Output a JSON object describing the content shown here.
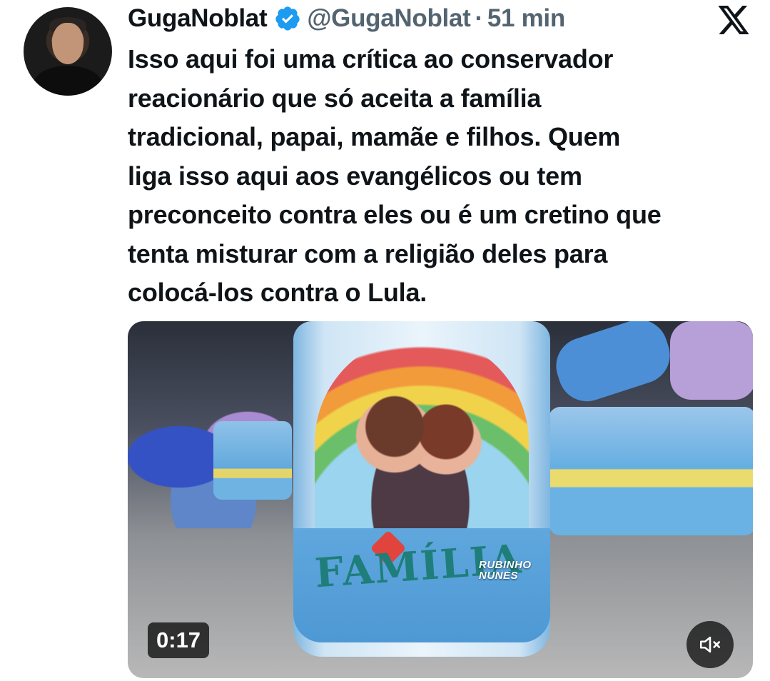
{
  "tweet": {
    "author_name": "GugaNoblat",
    "handle": "@GugaNoblat",
    "separator": "·",
    "time": "51 min",
    "verified": true,
    "text_lines": [
      "Isso aqui foi uma crítica ao conservador",
      "reacionário que só aceita a família",
      "tradicional, papai, mamãe e filhos. Quem",
      "liga isso aqui aos evangélicos ou tem",
      "preconceito contra eles ou é um cretino que",
      "tenta misturar com a religião deles para",
      "colocá-los contra o Lula."
    ]
  },
  "media": {
    "type": "video",
    "duration": "0:17",
    "can_label": "FAMÍLIA",
    "watermark_line1": "RUBINHO",
    "watermark_line2": "NUNES",
    "muted": true
  },
  "colors": {
    "text_primary": "#0f1419",
    "text_secondary": "#536471",
    "verified_badge": "#1d9bf0"
  },
  "icons": [
    "verified-badge-icon",
    "x-logo-icon",
    "volume-muted-icon"
  ]
}
